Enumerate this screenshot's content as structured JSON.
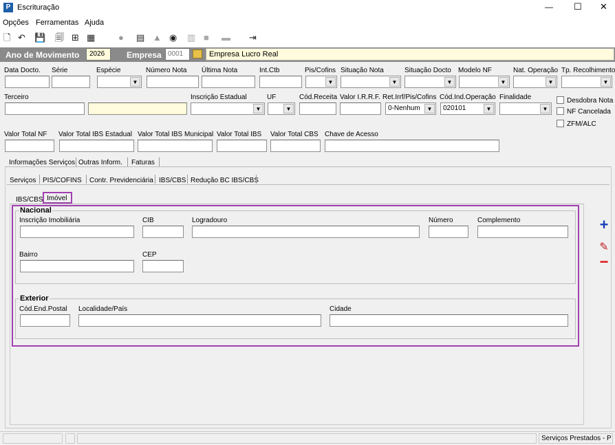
{
  "window": {
    "title": "Escrituração",
    "minimize": "—",
    "maximize": "☐",
    "close": "✕",
    "app_icon": "P"
  },
  "menu": [
    "Opções",
    "Ferramentas",
    "Ajuda"
  ],
  "header": {
    "ano_label": "Ano de Movimento",
    "ano_value": "2026",
    "empresa_label": "Empresa",
    "empresa_code": "0001",
    "empresa_name": "Empresa Lucro Real"
  },
  "row1": {
    "data_docto": "Data Docto.",
    "serie": "Série",
    "especie": "Espécie",
    "numero_nota": "Número Nota",
    "ultima_nota": "Última Nota",
    "int_ctb": "Int.Ctb",
    "pis_cofins": "Pis/Cofins",
    "situacao_nota": "Situação Nota",
    "situacao_docto": "Situação Docto",
    "modelo_nf": "Modelo NF",
    "nat_operacao": "Nat. Operação",
    "tp_recolhimento": "Tp. Recolhimento"
  },
  "row2": {
    "terceiro": "Terceiro",
    "inscricao_estadual": "Inscrição Estadual",
    "uf": "UF",
    "cod_receita": "Cód.Receita",
    "valor_irrf": "Valor I.R.R.F.",
    "ret_irrf": "Ret.Irrf/Pis/Cofins",
    "ret_irrf_value": "0-Nenhum",
    "cod_ind_operacao": "Cód.Ind.Operação",
    "cod_ind_operacao_value": "020101",
    "finalidade": "Finalidade"
  },
  "checks": {
    "desdobra": "Desdobra Nota",
    "nf_cancelada": "NF Cancelada",
    "zfm": "ZFM/ALC"
  },
  "row3": {
    "valor_total_nf": "Valor Total NF",
    "ibs_estadual": "Valor Total IBS Estadual",
    "ibs_municipal": "Valor Total IBS Municipal",
    "valor_ibs": "Valor Total IBS",
    "valor_cbs": "Valor Total CBS",
    "chave": "Chave de Acesso"
  },
  "tabs_main": [
    "Informações Serviços",
    "Outras Inform.",
    "Faturas"
  ],
  "tabs_sub": [
    "Serviços",
    "PIS/COFINS",
    "Contr. Previdenciária",
    "IBS/CBS",
    "Redução BC IBS/CBS"
  ],
  "tabs_inner": [
    "IBS/CBS",
    "Imóvel"
  ],
  "nacional": {
    "title": "Nacional",
    "inscricao": "Inscrição Imobiliária",
    "cib": "CIB",
    "logradouro": "Logradouro",
    "numero": "Número",
    "complemento": "Complemento",
    "bairro": "Bairro",
    "cep": "CEP"
  },
  "exterior": {
    "title": "Exterior",
    "cod_end": "Cód.End.Postal",
    "localidade": "Localidade/País",
    "cidade": "Cidade"
  },
  "side": {
    "add": "+",
    "edit": "✎",
    "remove": "−"
  },
  "status": {
    "right": "Serviços Prestados - P"
  },
  "colors": {
    "accent": "#a040b0",
    "header_bg": "#8a8a8a",
    "yellow": "#fffbdc"
  }
}
